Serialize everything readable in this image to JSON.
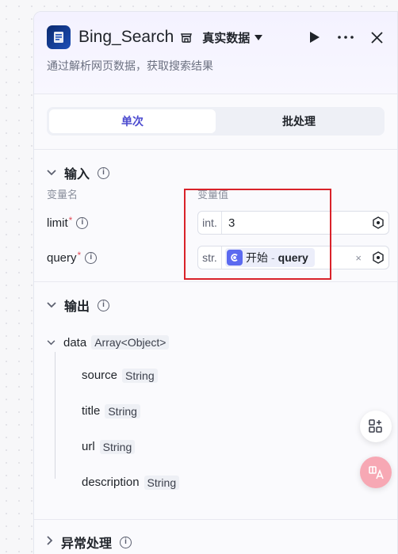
{
  "header": {
    "title": "Bing_Search",
    "data_mode": "真实数据",
    "description": "通过解析网页数据，获取搜索结果"
  },
  "tabs": [
    {
      "label": "单次",
      "active": true
    },
    {
      "label": "批处理",
      "active": false
    }
  ],
  "input": {
    "title": "输入",
    "col_name": "变量名",
    "col_value": "变量值",
    "params": [
      {
        "name": "limit",
        "required": true,
        "type": "int.",
        "value": "3"
      },
      {
        "name": "query",
        "required": true,
        "type": "str.",
        "ref_node": "开始",
        "ref_sep": "-",
        "ref_name": "query",
        "clear": "×"
      }
    ]
  },
  "output": {
    "title": "输出",
    "root": {
      "name": "data",
      "type": "Array<Object>"
    },
    "children": [
      {
        "name": "source",
        "type": "String"
      },
      {
        "name": "title",
        "type": "String"
      },
      {
        "name": "url",
        "type": "String"
      },
      {
        "name": "description",
        "type": "String"
      }
    ]
  },
  "exception": {
    "title": "异常处理"
  },
  "required_mark": "*",
  "info_glyph": "i",
  "colors": {
    "accent": "#4b4acf",
    "required": "#e34d59",
    "annotation": "#d9222a",
    "ref_node": "#5b6af0"
  }
}
